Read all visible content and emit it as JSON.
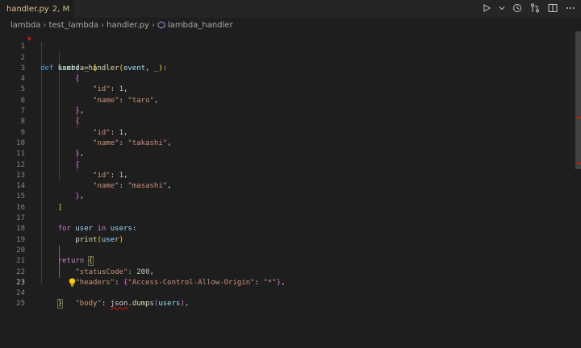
{
  "tab": {
    "filename": "handler.py",
    "status": "2, M"
  },
  "breadcrumb": [
    "lambda",
    "test_lambda",
    "handler.py",
    "lambda_handler"
  ],
  "actions": [
    "play-icon",
    "chevron-down-icon",
    "timeline-icon",
    "git-compare-icon",
    "split-editor-icon",
    "more-icon"
  ],
  "code": {
    "l1": {
      "num": "1",
      "def": "def",
      "fn": "lambda_handler",
      "open": "(",
      "p1": "event",
      "comma": ", ",
      "p2": "_",
      "close": ")",
      "colon": ":"
    },
    "l2": {
      "num": "2",
      "var": "users",
      "eq": " = ",
      "br": "["
    },
    "l3": {
      "num": "3",
      "br": "{"
    },
    "l4": {
      "num": "4",
      "key": "\"id\"",
      "sep": ": ",
      "val": "1",
      "end": ","
    },
    "l5": {
      "num": "5",
      "key": "\"name\"",
      "sep": ": ",
      "val": "\"taro\"",
      "end": ","
    },
    "l6": {
      "num": "6",
      "br": "}",
      "end": ","
    },
    "l7": {
      "num": "7",
      "br": "{"
    },
    "l8": {
      "num": "8",
      "key": "\"id\"",
      "sep": ": ",
      "val": "1",
      "end": ","
    },
    "l9": {
      "num": "9",
      "key": "\"name\"",
      "sep": ": ",
      "val": "\"takashi\"",
      "end": ","
    },
    "l10": {
      "num": "10",
      "br": "}",
      "end": ","
    },
    "l11": {
      "num": "11",
      "br": "{"
    },
    "l12": {
      "num": "12",
      "key": "\"id\"",
      "sep": ": ",
      "val": "1",
      "end": ","
    },
    "l13": {
      "num": "13",
      "key": "\"name\"",
      "sep": ": ",
      "val": "\"masashi\"",
      "end": ","
    },
    "l14": {
      "num": "14",
      "br": "}",
      "end": ","
    },
    "l15": {
      "num": "15",
      "br": "]"
    },
    "l16": {
      "num": "16"
    },
    "l17": {
      "num": "17",
      "for": "for",
      "v": "user",
      "in": "in",
      "v2": "users",
      "colon": ":"
    },
    "l18": {
      "num": "18",
      "fn": "print",
      "open": "(",
      "arg": "user",
      "close": ")"
    },
    "l19": {
      "num": "19"
    },
    "l20": {
      "num": "20",
      "ret": "return",
      "br": "{"
    },
    "l21": {
      "num": "21",
      "key": "\"statusCode\"",
      "sep": ": ",
      "val": "200",
      "end": ","
    },
    "l22": {
      "num": "22",
      "key": "\"headers\"",
      "sep": ": ",
      "open": "{",
      "k2": "\"Access-Control-Allow-Origin\"",
      "sep2": ": ",
      "v2": "\"*\"",
      "close": "}",
      "end": ","
    },
    "l23": {
      "num": "23",
      "key": "\"body\"",
      "sep": ": ",
      "mod": "json",
      "dot": ".",
      "fn": "dumps",
      "open": "(",
      "arg": "users",
      "close": ")",
      "end": ","
    },
    "l24": {
      "num": "24",
      "br": "}"
    },
    "l25": {
      "num": "25"
    }
  }
}
